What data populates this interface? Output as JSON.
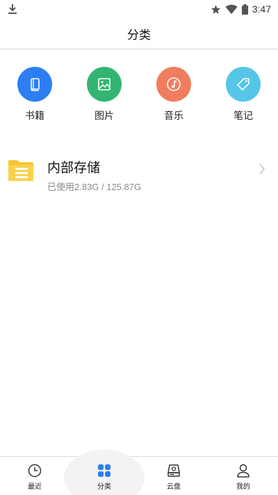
{
  "status_bar": {
    "time": "3:47",
    "icons": [
      "download-icon",
      "star-icon",
      "wifi-icon",
      "battery-icon"
    ]
  },
  "header": {
    "title": "分类"
  },
  "categories": [
    {
      "label": "书籍",
      "icon": "book-icon",
      "color": "#2c7ef2"
    },
    {
      "label": "图片",
      "icon": "image-icon",
      "color": "#33b571"
    },
    {
      "label": "音乐",
      "icon": "music-icon",
      "color": "#f07d5e"
    },
    {
      "label": "笔记",
      "icon": "tag-icon",
      "color": "#56c6e8"
    }
  ],
  "storage": {
    "name": "内部存储",
    "usage": "已使用2.83G / 125.87G",
    "icon": "folder-icon",
    "color": "#f6c532"
  },
  "bottom_nav": {
    "active": "分类",
    "items": [
      {
        "label": "最近",
        "icon": "clock-icon"
      },
      {
        "label": "分类",
        "icon": "grid-icon"
      },
      {
        "label": "云盘",
        "icon": "cloud-drive-icon"
      },
      {
        "label": "我的",
        "icon": "user-icon"
      }
    ]
  }
}
